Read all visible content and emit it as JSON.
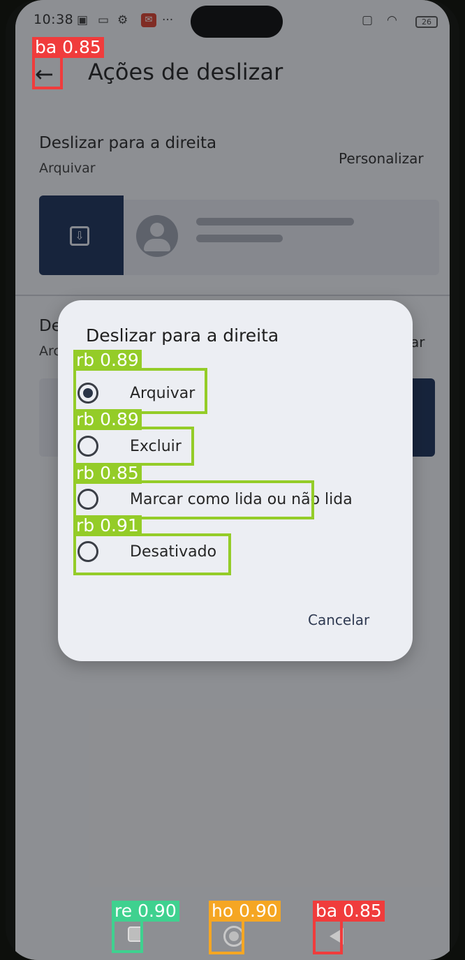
{
  "status_bar": {
    "time": "10:38",
    "battery": "26"
  },
  "app_bar": {
    "title": "Ações de deslizar"
  },
  "swipe_right": {
    "title": "Deslizar para a direita",
    "value": "Arquivar",
    "customize": "Personalizar"
  },
  "swipe_left": {
    "title": "De",
    "value": "Arc",
    "customize": "ar"
  },
  "dialog": {
    "title": "Deslizar para a direita",
    "options": [
      {
        "label": "Arquivar",
        "selected": true
      },
      {
        "label": "Excluir",
        "selected": false
      },
      {
        "label": "Marcar como lida ou não lida",
        "selected": false
      },
      {
        "label": "Desativado",
        "selected": false
      }
    ],
    "cancel": "Cancelar"
  },
  "detections": [
    {
      "cls": "ba",
      "score": "0.85"
    },
    {
      "cls": "rb",
      "score": "0.89"
    },
    {
      "cls": "rb",
      "score": "0.89"
    },
    {
      "cls": "rb",
      "score": "0.85"
    },
    {
      "cls": "rb",
      "score": "0.91"
    },
    {
      "cls": "re",
      "score": "0.90"
    },
    {
      "cls": "ho",
      "score": "0.90"
    },
    {
      "cls": "ba",
      "score": "0.85"
    }
  ],
  "colors": {
    "accent": "#172d56",
    "box_red": "#f03c3c",
    "box_green": "#94cc28",
    "box_teal": "#3fd18f",
    "box_orange": "#f5a623"
  }
}
